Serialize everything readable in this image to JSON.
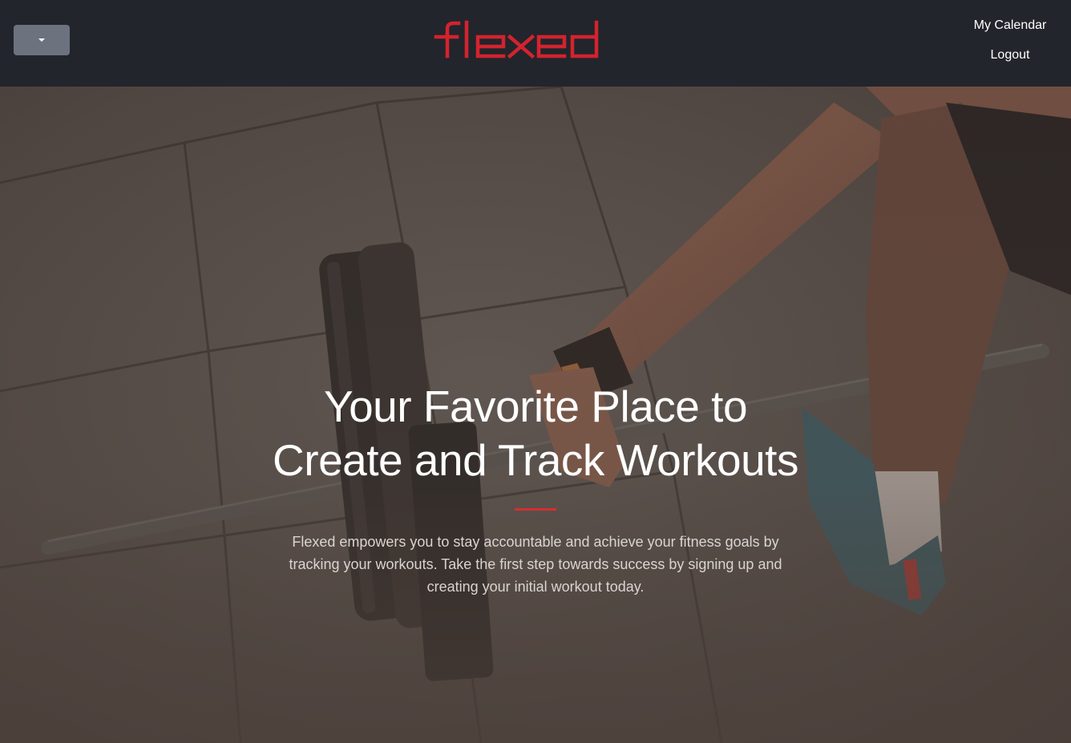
{
  "brand": {
    "name": "flexed",
    "color": "#d3232f"
  },
  "nav": {
    "dropdown_icon": "caret-down-icon",
    "links": [
      "My Calendar",
      "Logout"
    ]
  },
  "hero": {
    "title_line1": "Your Favorite Place to",
    "title_line2": "Create and Track Workouts",
    "accent_color": "#d32f2f",
    "description": "Flexed empowers you to stay accountable and achieve your fitness goals by tracking your workouts. Take the first step towards success by signing up and creating your initial workout today."
  },
  "colors": {
    "navbar_bg": "#22252b",
    "dropdown_bg": "#6c737e",
    "hero_bg": "#4d4440"
  }
}
